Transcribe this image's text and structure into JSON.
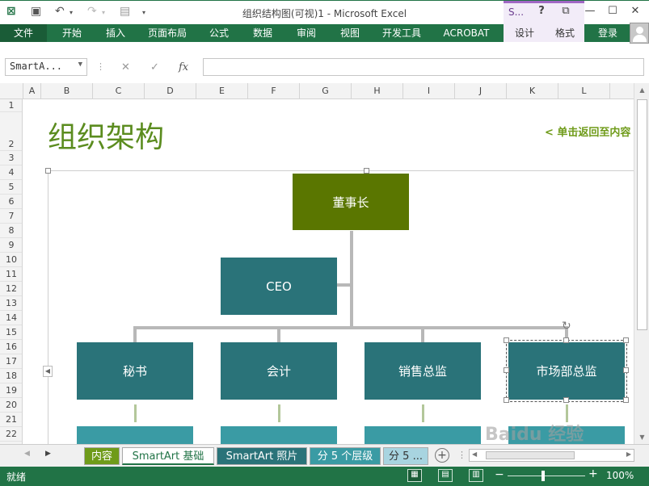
{
  "window": {
    "title": "组织结构图(可视)1 - Microsoft Excel",
    "contextual_tab": "S...",
    "help": "?",
    "restore": "⧉",
    "minimize": "—",
    "maximize": "☐",
    "close": "✕"
  },
  "ribbon": {
    "file": "文件",
    "tabs": [
      "开始",
      "插入",
      "页面布局",
      "公式",
      "数据",
      "审阅",
      "视图",
      "开发工具",
      "ACROBAT"
    ],
    "design": "设计",
    "format": "格式",
    "login": "登录"
  },
  "formula_bar": {
    "name_box": "SmartA...",
    "cancel": "✕",
    "confirm": "✓",
    "fx": "fx",
    "formula": ""
  },
  "columns": [
    "A",
    "B",
    "C",
    "D",
    "E",
    "F",
    "G",
    "H",
    "I",
    "J",
    "K",
    "L"
  ],
  "rows": [
    "1",
    "2",
    "3",
    "4",
    "5",
    "6",
    "7",
    "8",
    "9",
    "10",
    "11",
    "12",
    "13",
    "14",
    "15",
    "16",
    "17",
    "18",
    "19",
    "20",
    "21",
    "22"
  ],
  "sheet": {
    "title": "组织架构",
    "back_link": "< 单击返回至内容"
  },
  "org_chart": {
    "chairman": "董事长",
    "ceo": "CEO",
    "secretary": "秘书",
    "accountant": "会计",
    "sales_director": "销售总监",
    "marketing_director": "市场部总监"
  },
  "sheet_tabs": [
    "内容",
    "SmartArt 基础",
    "SmartArt 照片",
    "分 5 个层级",
    "分 5 ..."
  ],
  "status": {
    "ready": "就绪",
    "zoom": "100%",
    "zoom_minus": "−",
    "zoom_plus": "+"
  },
  "watermark": "Baidu 经验",
  "colors": {
    "excel_green": "#217346",
    "title_green": "#5b8c1f",
    "chairman_node": "#5a7600",
    "teal_node": "#2a7379",
    "light_teal_node": "#3a9ba4"
  }
}
